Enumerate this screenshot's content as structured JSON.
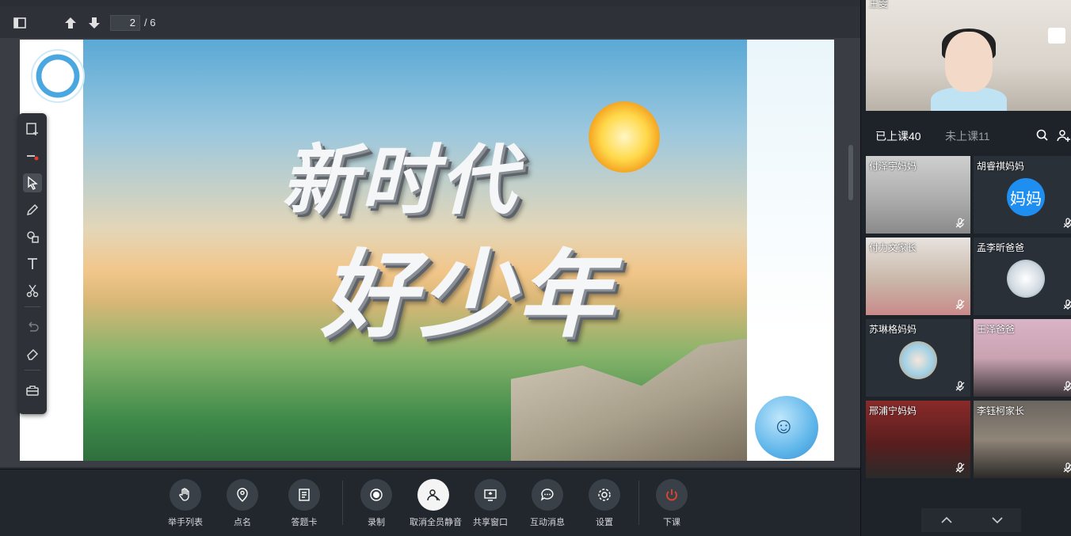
{
  "toolbar": {
    "page_current": "2",
    "page_total": "/ 6"
  },
  "slide": {
    "title_line1": "新时代",
    "title_line2": "好少年"
  },
  "controls": [
    {
      "label": "举手列表",
      "icon": "hand-icon"
    },
    {
      "label": "点名",
      "icon": "roll-call-icon"
    },
    {
      "label": "答题卡",
      "icon": "answer-card-icon"
    },
    {
      "label": "录制",
      "icon": "record-icon"
    },
    {
      "label": "取消全员静音",
      "icon": "unmute-all-icon"
    },
    {
      "label": "共享窗口",
      "icon": "share-window-icon"
    },
    {
      "label": "互动消息",
      "icon": "chat-icon"
    },
    {
      "label": "设置",
      "icon": "gear-icon"
    },
    {
      "label": "下课",
      "icon": "power-icon"
    }
  ],
  "teacher": {
    "name": "王雯"
  },
  "tabs": {
    "attended": "已上课40",
    "absent": "未上课11"
  },
  "participants": [
    {
      "name": "付泽宇妈妈",
      "type": "video"
    },
    {
      "name": "胡睿祺妈妈",
      "type": "avatar-text",
      "avatar_text": "妈妈"
    },
    {
      "name": "付力文家长",
      "type": "video"
    },
    {
      "name": "孟李昕爸爸",
      "type": "avatar"
    },
    {
      "name": "苏琳格妈妈",
      "type": "avatar"
    },
    {
      "name": "王泽爸爸",
      "type": "video"
    },
    {
      "name": "邢浦宁妈妈",
      "type": "video"
    },
    {
      "name": "李钰柯家长",
      "type": "video"
    }
  ],
  "colors": {
    "accent": "#1f8ef1",
    "end_class": "#e8452c",
    "panel_bg": "#1e232a"
  }
}
